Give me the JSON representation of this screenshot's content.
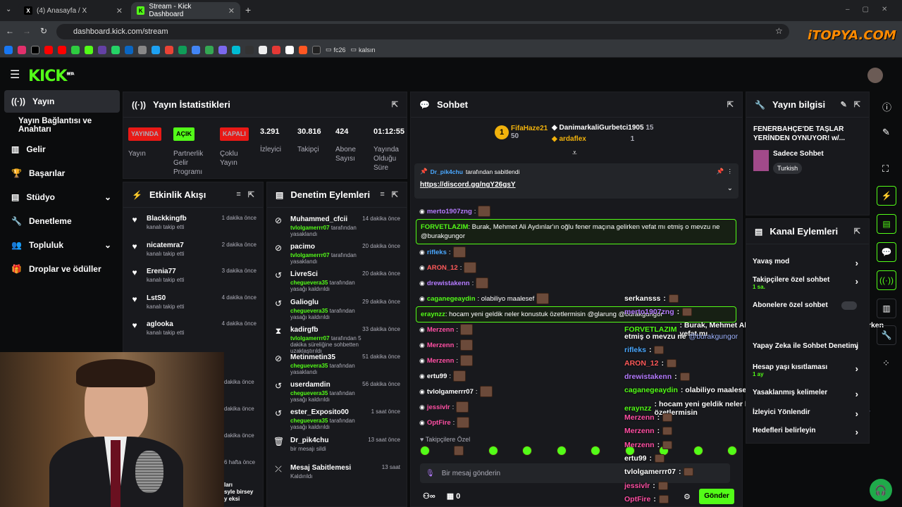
{
  "browser": {
    "tab1": "(4) Anasayfa / X",
    "tab2": "Stream - Kick Dashboard",
    "url": "dashboard.kick.com/stream",
    "bookmarks": [
      "fc26",
      "kalsın"
    ],
    "watermark": "iTOPYA.COM"
  },
  "app": {
    "logo": "KICK",
    "beta": "BETA"
  },
  "sidebar": {
    "items": [
      {
        "label": "Yayın",
        "icon": "broadcast-icon"
      },
      {
        "label": "Yayın Bağlantısı ve Anahtarı",
        "icon": ""
      },
      {
        "label": "Gelir",
        "icon": "chart-icon"
      },
      {
        "label": "Başarılar",
        "icon": "trophy-icon"
      },
      {
        "label": "Stüdyo",
        "icon": "studio-icon"
      },
      {
        "label": "Denetleme",
        "icon": "wrench-icon"
      },
      {
        "label": "Topluluk",
        "icon": "community-icon"
      },
      {
        "label": "Droplar ve ödüller",
        "icon": "gift-icon"
      }
    ]
  },
  "stats": {
    "title": "Yayın İstatistikleri",
    "cols": [
      {
        "badge": "YAYINDA",
        "label": "Yayın",
        "color": "#e91916"
      },
      {
        "badge": "AÇIK",
        "label": "Partnerlik Gelir Programı",
        "color": "#53fc18"
      },
      {
        "badge": "KAPALI",
        "label": "Çoklu Yayın",
        "color": "#e91916"
      },
      {
        "value": "3.291",
        "label": "İzleyici"
      },
      {
        "value": "30.816",
        "label": "Takipçi"
      },
      {
        "value": "424",
        "label": "Abone Sayısı"
      },
      {
        "value": "01:12:55",
        "label": "Yayında Olduğu Süre"
      }
    ]
  },
  "activity": {
    "title": "Etkinlik Akışı",
    "rows": [
      {
        "name": "Blackkingfb",
        "sub": "kanalı takip etti",
        "time": "1 dakika önce"
      },
      {
        "name": "nicatemra7",
        "sub": "kanalı takip etti",
        "time": "2 dakika önce"
      },
      {
        "name": "Erenia77",
        "sub": "kanalı takip etti",
        "time": "3 dakika önce"
      },
      {
        "name": "LstS0",
        "sub": "kanalı takip etti",
        "time": "4 dakika önce"
      },
      {
        "name": "aglooka",
        "sub": "kanalı takip etti",
        "time": "4 dakika önce"
      }
    ],
    "extra_times": [
      "dakika önce",
      "dakika önce",
      "dakika önce",
      "6 hafta önce"
    ],
    "clip": [
      "ları",
      "syle birsey",
      "y eksi"
    ]
  },
  "moderation": {
    "title": "Denetim Eylemleri",
    "rows": [
      {
        "name": "Muhammed_cfcii",
        "user": "tvlolgamerrr07",
        "action": "tarafından yasaklandı",
        "time": "14 dakika önce",
        "icon": "ban-icon"
      },
      {
        "name": "pacimo",
        "user": "tvlolgamerrr07",
        "action": "tarafından yasaklandı",
        "time": "20 dakika önce",
        "icon": "ban-icon"
      },
      {
        "name": "LivreSci",
        "user": "cheguevera35",
        "action": "tarafından yasağı kaldırıldı",
        "time": "20 dakika önce",
        "icon": "undo-icon"
      },
      {
        "name": "Galioglu",
        "user": "cheguevera35",
        "action": "tarafından yasağı kaldırıldı",
        "time": "29 dakika önce",
        "icon": "undo-icon"
      },
      {
        "name": "kadirgfb",
        "user": "tvlolgamerrr07",
        "action": "tarafından 5 dakika süreliğine sohbetten uzaklaştırıldı",
        "time": "33 dakika önce",
        "icon": "hourglass-icon"
      },
      {
        "name": "Metinmetin35",
        "user": "cheguevera35",
        "action": "tarafından yasaklandı",
        "time": "51 dakika önce",
        "icon": "ban-icon"
      },
      {
        "name": "userdamdin",
        "user": "cheguevera35",
        "action": "tarafından yasağı kaldırıldı",
        "time": "56 dakika önce",
        "icon": "undo-icon"
      },
      {
        "name": "ester_Exposito00",
        "user": "cheguevera35",
        "action": "tarafından yasağı kaldırıldı",
        "time": "1 saat önce",
        "icon": "undo-icon"
      },
      {
        "name": "Dr_pik4chu",
        "user": "",
        "action": "bir mesajı sildi",
        "time": "13 saat önce",
        "icon": "trash-icon"
      },
      {
        "name": "Mesaj Sabitlemesi",
        "user": "",
        "action": "Kaldırıldı",
        "time": "13 saat",
        "icon": "unpin-icon"
      }
    ]
  },
  "chat": {
    "title": "Sohbet",
    "top1_name": "FifaHaze21",
    "top1_count": "50",
    "top2_name": "DanimarkaliGurbetci1905",
    "top2_count": "15",
    "top3_name": "ardaflex",
    "top3_count": "1",
    "pinned_by": "Dr_pik4chu",
    "pinned_text": "tarafından sabitlendi",
    "pinned_link": "https://discord.gg/ngY26gsY",
    "messages": [
      {
        "user": "merto1907zng",
        "text": ":",
        "color": "#b57bff"
      },
      {
        "user": "FORVETLAZIM",
        "text": ": Burak, Mehmet Ali Aydınlar'ın oğlu fener maçına gelirken vefat mı etmiş o mevzu ne @burakgungor",
        "color": "#53fc18",
        "hl": true
      },
      {
        "user": "rifleks",
        "text": ":",
        "color": "#4aa8ff"
      },
      {
        "user": "ARON_12",
        "text": ":",
        "color": "#ff5a5a"
      },
      {
        "user": "drewistakenn",
        "text": ":",
        "color": "#b57bff"
      },
      {
        "user": "caganegeaydin",
        "text": ": olabiliyo maalesef",
        "color": "#53fc18"
      },
      {
        "user": "eraynzz",
        "text": ": hocam yeni geldik neler konustuk özetlermisin @glarung @burakgungor",
        "color": "#53fc18",
        "hl": true
      },
      {
        "user": "Merzenn",
        "text": ":",
        "color": "#ff4fa3"
      },
      {
        "user": "Merzenn",
        "text": ":",
        "color": "#ff4fa3"
      },
      {
        "user": "Merzenn",
        "text": ":",
        "color": "#ff4fa3"
      },
      {
        "user": "ertu99",
        "text": ":",
        "color": "#fff"
      },
      {
        "user": "tvlolgamerrr07",
        "text": ":",
        "color": "#fff"
      },
      {
        "user": "jessivlr",
        "text": ":",
        "color": "#ff4fa3"
      },
      {
        "user": "OptFire",
        "text": ":",
        "color": "#ff4fa3"
      }
    ],
    "followers_only": "Takipçilere Özel",
    "input_placeholder": "Bir mesaj gönderin",
    "viewers_val": "0",
    "send": "Gönder"
  },
  "overlay": {
    "messages": [
      {
        "user": "serkansss",
        "text": ":",
        "color": "#fff"
      },
      {
        "user": "merto1907zng",
        "text": ":",
        "color": "#b57bff"
      },
      {
        "user": "FORVETLAZIM",
        "text": ": Burak, Mehmet Ali Aydınlar'ın oğlu fener maçına gelirken vefat mı",
        "color": "#53fc18"
      },
      {
        "user": "",
        "text": "etmiş o mevzu ne",
        "mention": "@burakgungor",
        "color": "#fff"
      },
      {
        "user": "rifleks",
        "text": ":",
        "color": "#4aa8ff"
      },
      {
        "user": "ARON_12",
        "text": ":",
        "color": "#ff5a5a"
      },
      {
        "user": "drewistakenn",
        "text": ":",
        "color": "#b57bff"
      },
      {
        "user": "caganegeaydin",
        "text": ": olabiliyo maalesef",
        "color": "#53fc18"
      },
      {
        "user": "eraynzz",
        "text": ": hocam yeni geldik neler konustuk özetlermisin",
        "mention": "@glarung @burakgungor",
        "color": "#53fc18"
      },
      {
        "user": "Merzenn",
        "text": ":",
        "color": "#ff4fa3"
      },
      {
        "user": "Merzenn",
        "text": ":",
        "color": "#ff4fa3"
      },
      {
        "user": "Merzenn",
        "text": ":",
        "color": "#ff4fa3"
      },
      {
        "user": "ertu99",
        "text": ":",
        "color": "#fff"
      },
      {
        "user": "tvlolgamerrr07",
        "text": ":",
        "color": "#fff"
      },
      {
        "user": "jessivlr",
        "text": ":",
        "color": "#ff4fa3"
      },
      {
        "user": "OptFire",
        "text": ":",
        "color": "#ff4fa3"
      }
    ]
  },
  "stream_info": {
    "title": "Yayın bilgisi",
    "stream_title": "FENERBAHÇE'DE TAŞLAR YERİNDEN OYNUYOR! w/...",
    "category": "Sadece Sohbet",
    "language": "Turkish"
  },
  "channel_actions": {
    "title": "Kanal Eylemleri",
    "items": [
      {
        "label": "Yavaş mod",
        "sub": ""
      },
      {
        "label": "Takipçilere özel sohbet",
        "sub": "1 sa."
      },
      {
        "label": "Abonelere özel sohbet",
        "sub": ""
      },
      {
        "label": "Yapay Zeka ile Sohbet Denetimi",
        "sub": ""
      },
      {
        "label": "Hesap yaşı kısıtlaması",
        "sub": "1 ay"
      },
      {
        "label": "Yasaklanmış kelimeler",
        "sub": ""
      },
      {
        "label": "İzleyici Yönlendir",
        "sub": ""
      },
      {
        "label": "Hedefleri belirleyin",
        "sub": ""
      }
    ]
  }
}
